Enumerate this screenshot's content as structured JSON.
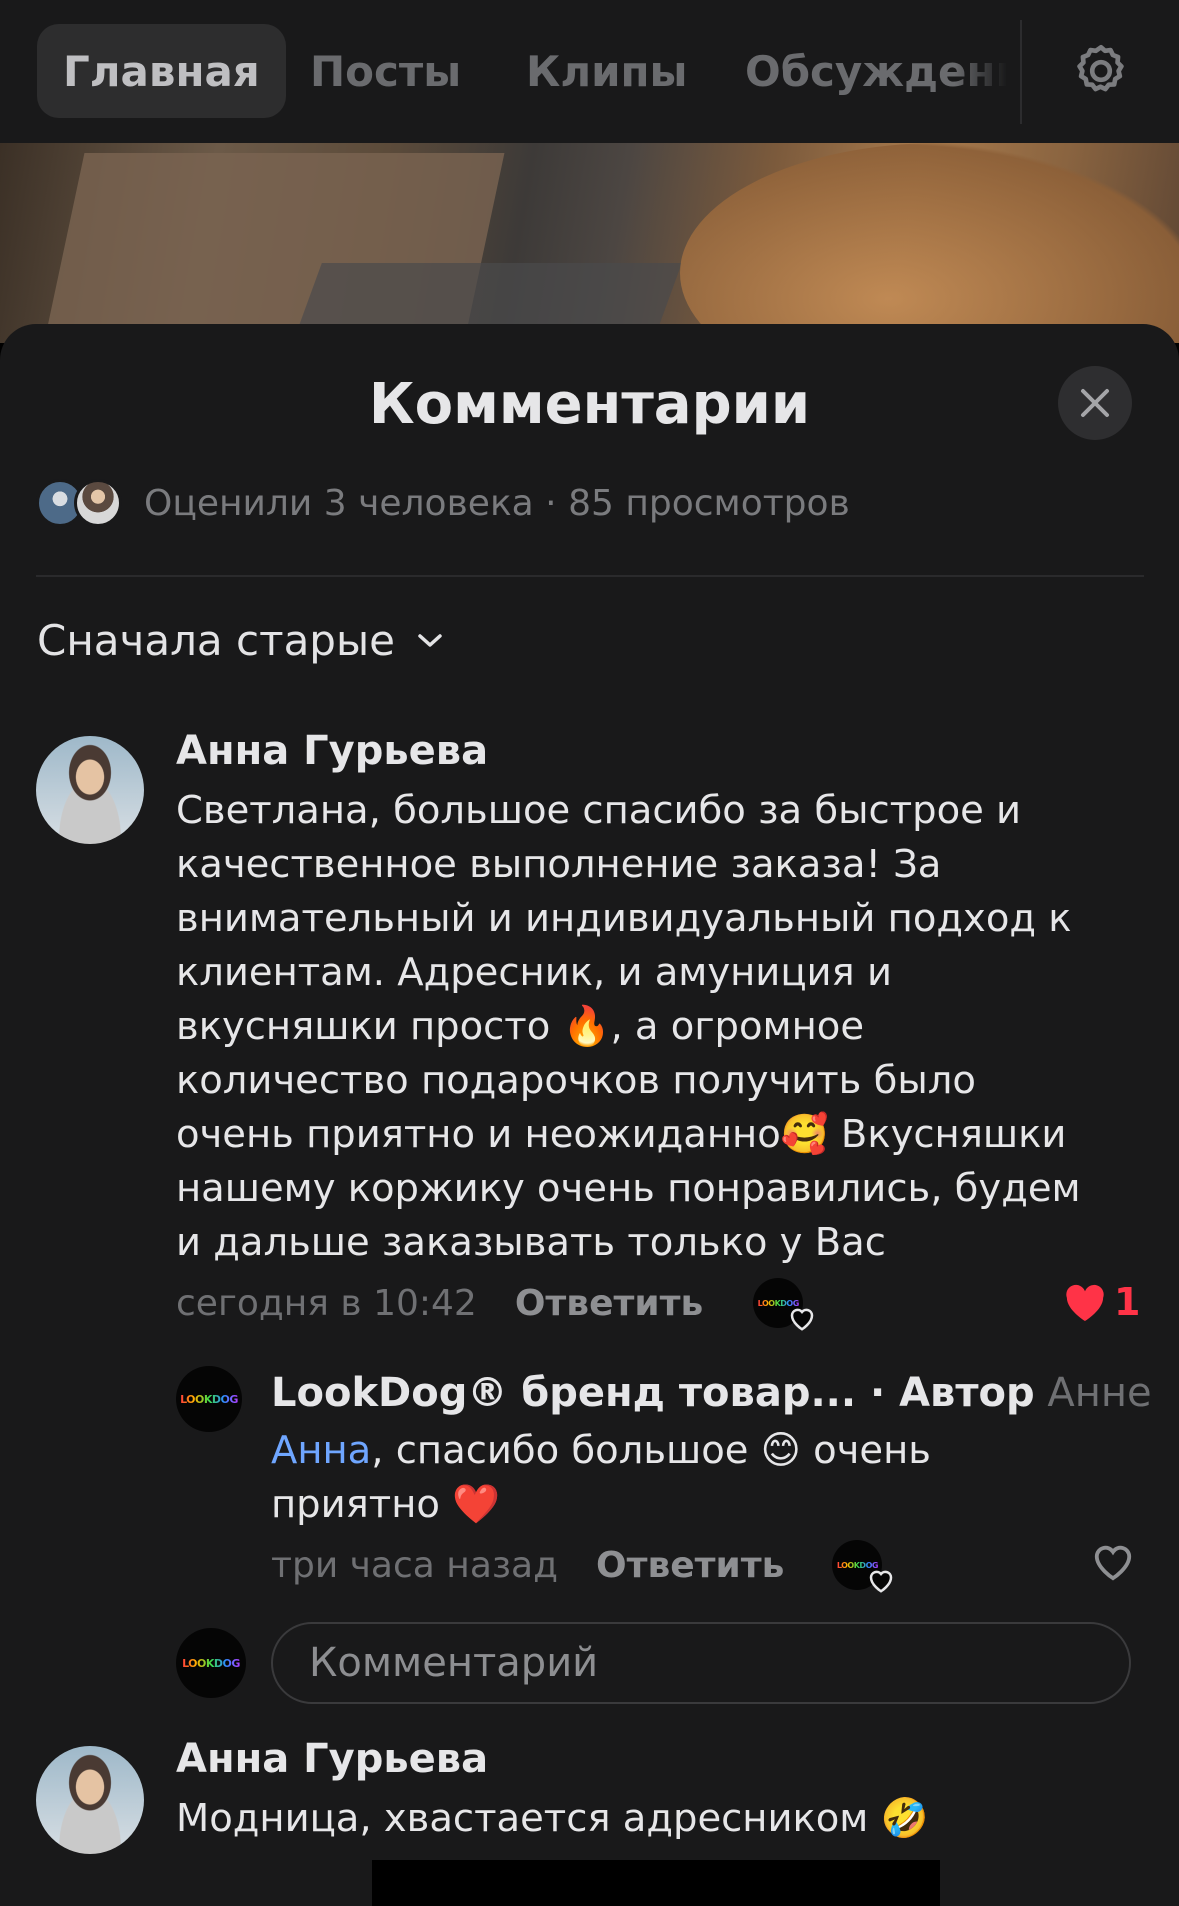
{
  "nav": {
    "tabs": [
      "Главная",
      "Посты",
      "Клипы",
      "Обсуждени"
    ],
    "active_tab": "Главная"
  },
  "sheet": {
    "title": "Комментарии",
    "stats": "Оценили 3 человека · 85 просмотров",
    "sort_label": "Сначала старые"
  },
  "comments": [
    {
      "author": "Анна Гурьева",
      "text_lines": [
        "Светлана, большое спасибо за быстрое и",
        "качественное выполнение заказа! За",
        "внимательный и индивидуальный подход  к",
        "клиентам. Адресник, и амуниция и",
        "вкусняшки просто 🔥, а огромное",
        "количество подарочков получить было",
        "очень приятно и неожиданно🥰 Вкусняшки",
        "нашему коржику очень понравились, будем",
        "и дальше заказывать только у Вас"
      ],
      "time": "сегодня в 10:42",
      "reply_label": "Ответить",
      "like_count": "1"
    },
    {
      "author": "Анна Гурьева",
      "text": "Модница, хвастается адресником 🤣"
    }
  ],
  "reply": {
    "author": "LookDog® бренд товар...",
    "badge": " · Автор",
    "reply_to": "Анне",
    "mention": "Анна",
    "text_line1": ", спасибо большое 😊 очень",
    "text_line2": "приятно ❤️",
    "time": "три часа назад",
    "reply_label": "Ответить",
    "logo_text": "LOOKDOG"
  },
  "input": {
    "placeholder": "Комментарий"
  },
  "colors": {
    "background": "#19191a",
    "accent_like": "#ff3347",
    "mention": "#6fa6ff"
  }
}
